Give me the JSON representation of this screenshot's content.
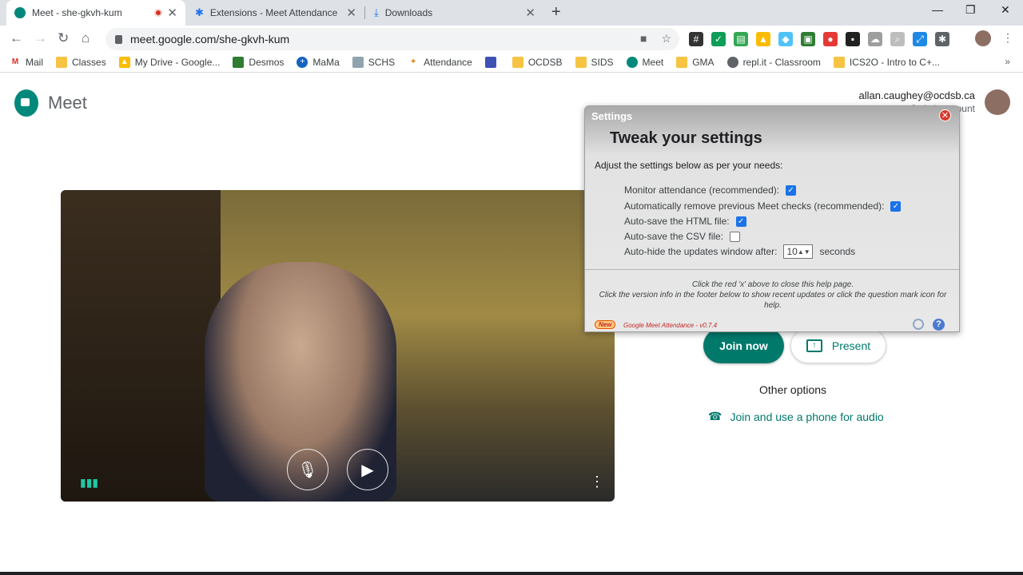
{
  "browser": {
    "tabs": [
      {
        "title": "Meet - she-gkvh-kum",
        "active": true,
        "recording": true
      },
      {
        "title": "Extensions - Meet Attendance",
        "active": false
      },
      {
        "title": "Downloads",
        "active": false
      }
    ],
    "url": "meet.google.com/she-gkvh-kum",
    "bookmarks": [
      "Mail",
      "Classes",
      "My Drive - Google...",
      "Desmos",
      "MaMa",
      "SCHS",
      "Attendance",
      "OCDSB",
      "SIDS",
      "Meet",
      "GMA",
      "repl.it - Classroom",
      "ICS2O - Intro to C+..."
    ],
    "bookmarks_overflow": "»"
  },
  "meet": {
    "logo_text": "Meet",
    "account_email": "allan.caughey@ocdsb.ca",
    "switch_account": "Switch account",
    "join_now": "Join now",
    "present": "Present",
    "other_options": "Other options",
    "phone_audio": "Join and use a phone for audio"
  },
  "settings_dialog": {
    "window_title": "Settings",
    "heading": "Tweak your settings",
    "intro": "Adjust the settings below as per your needs:",
    "monitor_attendance": {
      "label": "Monitor attendance (recommended):",
      "checked": true
    },
    "auto_remove": {
      "label": "Automatically remove previous Meet checks (recommended):",
      "checked": true
    },
    "auto_save_html": {
      "label": "Auto-save the HTML file:",
      "checked": true
    },
    "auto_save_csv": {
      "label": "Auto-save the CSV file:",
      "checked": false
    },
    "auto_hide": {
      "label": "Auto-hide the updates window after:",
      "value": "10",
      "suffix": "seconds"
    },
    "help_line1": "Click the red 'x' above to close this help page.",
    "help_line2": "Click the version info in the footer below to show recent updates or click the question mark icon for help.",
    "footer_new": "New",
    "footer_version": "Google Meet Attendance - v0.7.4"
  },
  "colors": {
    "meet_green": "#00796b",
    "record_red": "#d93025",
    "checkbox_blue": "#1a73e8"
  }
}
